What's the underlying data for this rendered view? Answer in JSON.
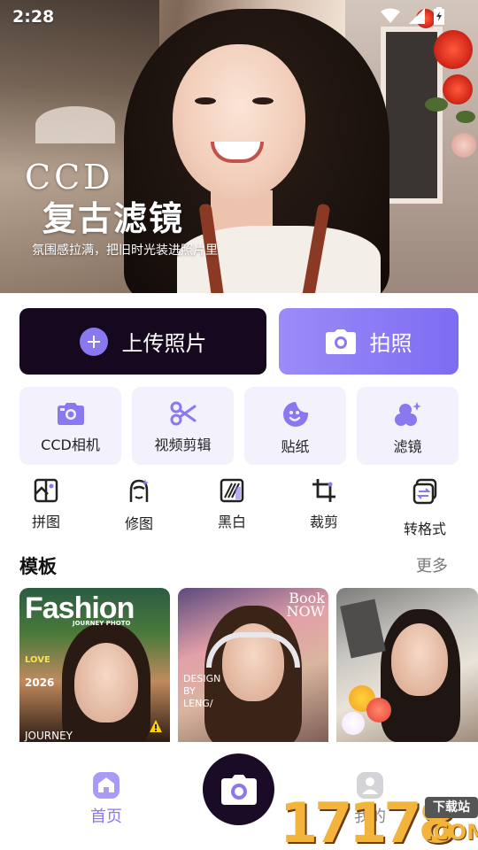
{
  "status_bar": {
    "time": "2:28"
  },
  "hero": {
    "title_line1": "CCD",
    "title_line2": "复古滤镜",
    "subtitle": "氛围感拉满，把旧时光装进照片里"
  },
  "actions": {
    "upload_label": "上传照片",
    "photo_label": "拍照"
  },
  "features": [
    {
      "label": "CCD相机",
      "icon": "camera-icon"
    },
    {
      "label": "视频剪辑",
      "icon": "scissors-icon"
    },
    {
      "label": "贴纸",
      "icon": "sticker-icon"
    },
    {
      "label": "滤镜",
      "icon": "filter-icon"
    }
  ],
  "tools": [
    {
      "label": "拼图",
      "icon": "collage-icon"
    },
    {
      "label": "修图",
      "icon": "retouch-icon"
    },
    {
      "label": "黑白",
      "icon": "black-white-icon"
    },
    {
      "label": "裁剪",
      "icon": "crop-icon"
    },
    {
      "label": "转格式",
      "icon": "convert-format-icon"
    }
  ],
  "templates_section": {
    "title": "模板",
    "more": "更多",
    "items": [
      {
        "headline": "Fashion",
        "caption_top": "JOURNEY PHOTO",
        "caption_mid": "LOVE",
        "year": "2026",
        "caption_bottom": "JOURNEY"
      },
      {
        "headline": "Book NOW",
        "caption_mid": "DESIGN BY LENG/"
      },
      {
        "headline": ""
      }
    ]
  },
  "bottom_nav": {
    "home_label": "首页",
    "mine_label": "我的"
  },
  "watermark": {
    "number": "17178",
    "tag": "下载站",
    "domain": ".COM"
  },
  "colors": {
    "accent": "#8a78f0",
    "dark": "#15081f",
    "card_bg": "#f2f1fc"
  }
}
